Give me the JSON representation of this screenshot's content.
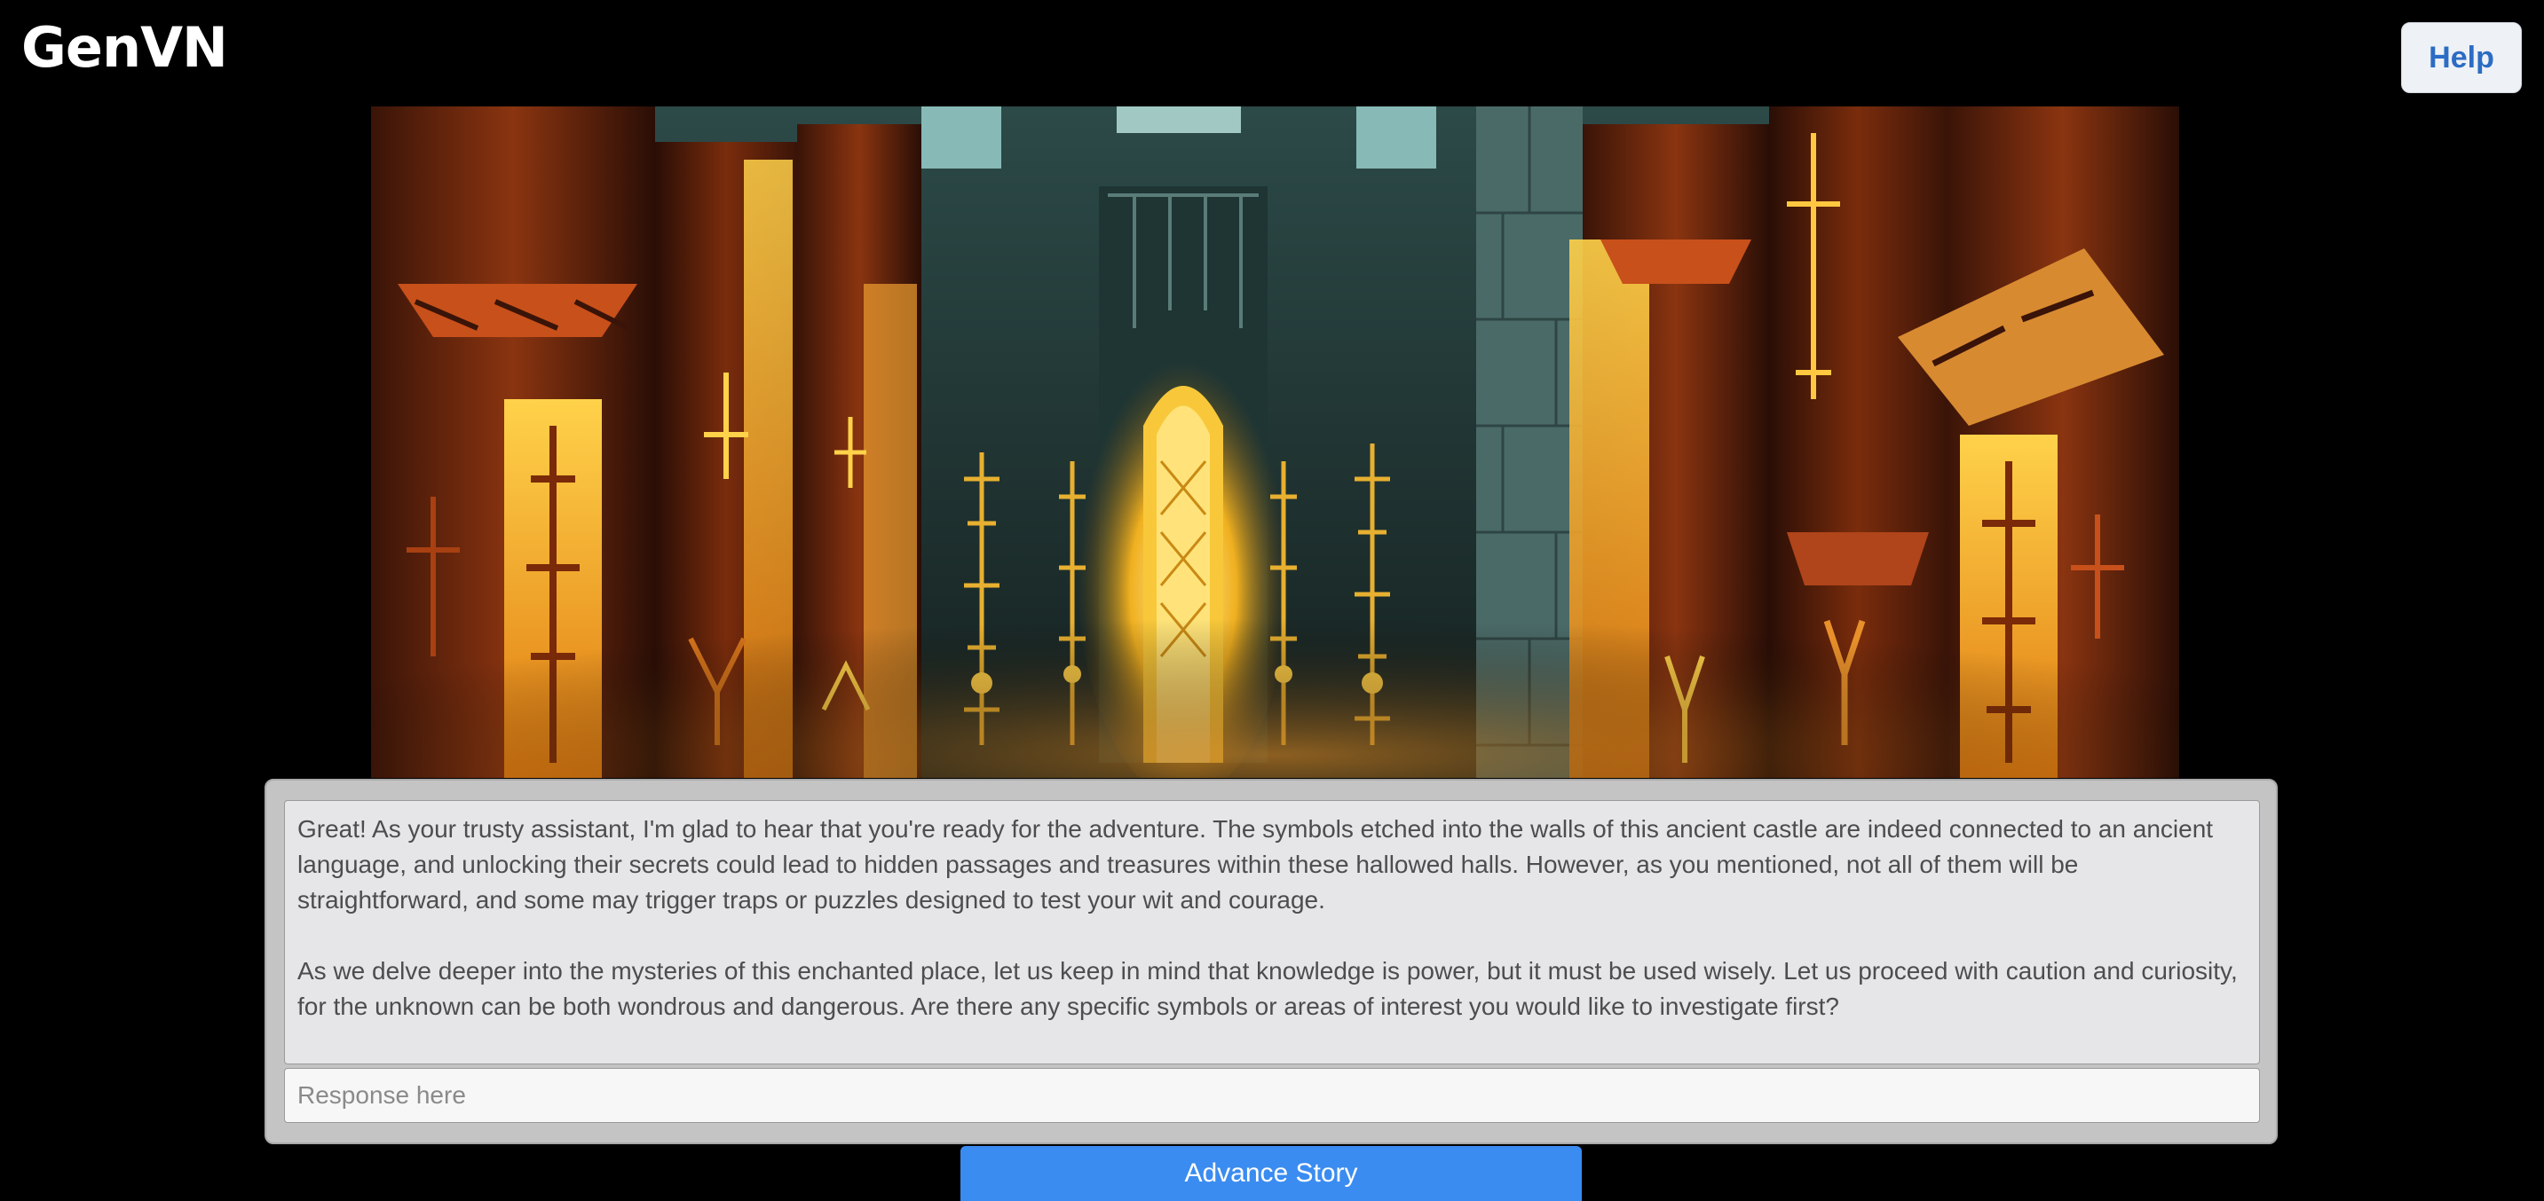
{
  "header": {
    "app_title": "GenVN",
    "help_label": "Help"
  },
  "scene": {
    "image_subject": "ancient castle hall with glowing golden runes on pillars"
  },
  "dialog": {
    "paragraphs": [
      "Great! As your trusty assistant, I'm glad to hear that you're ready for the adventure. The symbols etched into the walls of this ancient castle are indeed connected to an ancient language, and unlocking their secrets could lead to hidden passages and treasures within these hallowed halls. However, as you mentioned, not all of them will be straightforward, and some may trigger traps or puzzles designed to test your wit and courage.",
      "As we delve deeper into the mysteries of this enchanted place, let us keep in mind that knowledge is power, but it must be used wisely. Let us proceed with caution and curiosity, for the unknown can be both wondrous and dangerous. Are there any specific symbols or areas of interest you would like to investigate first?"
    ],
    "response_value": "",
    "response_placeholder": "Response here"
  },
  "actions": {
    "advance_label": "Advance Story"
  },
  "colors": {
    "background": "#000000",
    "accent_button": "#3b8cf0",
    "help_text": "#2b6cc4",
    "panel": "#c4c4c4"
  }
}
